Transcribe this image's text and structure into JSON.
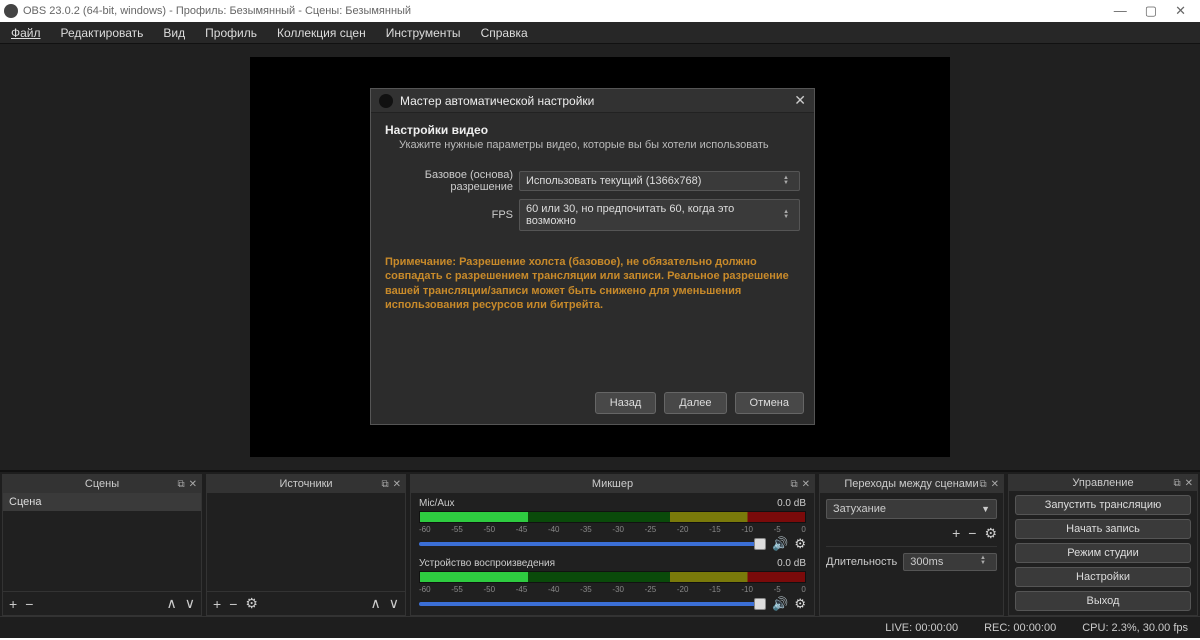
{
  "window": {
    "title": "OBS 23.0.2 (64-bit, windows) - Профиль: Безымянный - Сцены: Безымянный"
  },
  "menubar": [
    "Файл",
    "Редактировать",
    "Вид",
    "Профиль",
    "Коллекция сцен",
    "Инструменты",
    "Справка"
  ],
  "modal": {
    "title": "Мастер автоматической настройки",
    "heading": "Настройки видео",
    "subheading": "Укажите нужные параметры видео, которые вы бы хотели использовать",
    "rows": {
      "base_res_label": "Базовое (основа) разрешение",
      "base_res_value": "Использовать текущий (1366x768)",
      "fps_label": "FPS",
      "fps_value": "60 или 30, но предпочитать 60, когда это возможно"
    },
    "note": "Примечание: Разрешение холста (базовое), не обязательно должно совпадать с разрешением трансляции или записи. Реальное разрешение вашей трансляции/записи может быть снижено для уменьшения использования ресурсов или битрейта.",
    "buttons": {
      "back": "Назад",
      "next": "Далее",
      "cancel": "Отмена"
    }
  },
  "panels": {
    "scenes": {
      "title": "Сцены",
      "item": "Сцена"
    },
    "sources": {
      "title": "Источники"
    },
    "mixer": {
      "title": "Микшер",
      "tracks": [
        {
          "name": "Mic/Aux",
          "level": "0.0 dB"
        },
        {
          "name": "Устройство воспроизведения",
          "level": "0.0 dB"
        }
      ],
      "ticks": [
        "-60",
        "-55",
        "-50",
        "-45",
        "-40",
        "-35",
        "-30",
        "-25",
        "-20",
        "-15",
        "-10",
        "-5",
        "0"
      ]
    },
    "transitions": {
      "title": "Переходы между сценами",
      "selected": "Затухание",
      "duration_label": "Длительность",
      "duration_value": "300ms"
    },
    "controls": {
      "title": "Управление",
      "buttons": [
        "Запустить трансляцию",
        "Начать запись",
        "Режим студии",
        "Настройки",
        "Выход"
      ]
    }
  },
  "status": {
    "live": "LIVE: 00:00:00",
    "rec": "REC: 00:00:00",
    "cpu": "CPU: 2.3%, 30.00 fps"
  }
}
